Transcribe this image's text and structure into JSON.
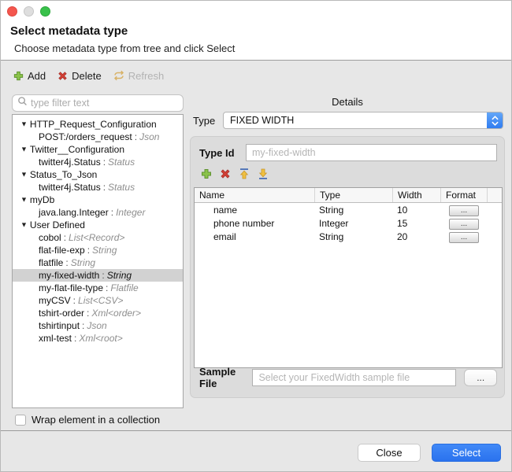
{
  "window": {
    "title": "Select metadata type",
    "subtitle": "Choose metadata type from tree and click Select"
  },
  "toolbar": {
    "add": "Add",
    "delete": "Delete",
    "refresh": "Refresh"
  },
  "filter": {
    "placeholder": "type filter text"
  },
  "tree": {
    "items": [
      {
        "label": "HTTP_Request_Configuration",
        "parent": true
      },
      {
        "label": "POST:/orders_request",
        "type": "Json"
      },
      {
        "label": "Twitter__Configuration",
        "parent": true
      },
      {
        "label": "twitter4j.Status",
        "type": "Status"
      },
      {
        "label": "Status_To_Json",
        "parent": true
      },
      {
        "label": "twitter4j.Status",
        "type": "Status"
      },
      {
        "label": "myDb",
        "parent": true
      },
      {
        "label": "java.lang.Integer",
        "type": "Integer"
      },
      {
        "label": "User Defined",
        "parent": true
      },
      {
        "label": "cobol",
        "type": "List<Record>"
      },
      {
        "label": "flat-file-exp",
        "type": "String"
      },
      {
        "label": "flatfile",
        "type": "String"
      },
      {
        "label": "my-fixed-width",
        "type": "String",
        "selected": true
      },
      {
        "label": "my-flat-file-type",
        "type": "Flatfile"
      },
      {
        "label": "myCSV",
        "type": "List<CSV>"
      },
      {
        "label": "tshirt-order",
        "type": "Xml<order>"
      },
      {
        "label": "tshirtinput",
        "type": "Json"
      },
      {
        "label": "xml-test",
        "type": "Xml<root>"
      }
    ]
  },
  "details": {
    "header": "Details",
    "type_label": "Type",
    "type_value": "FIXED WIDTH",
    "type_id_label": "Type Id",
    "type_id_placeholder": "my-fixed-width",
    "table": {
      "headers": [
        "Name",
        "Type",
        "Width",
        "Format"
      ],
      "rows": [
        {
          "name": "name",
          "type": "String",
          "width": "10",
          "format": "..."
        },
        {
          "name": "phone number",
          "type": "Integer",
          "width": "15",
          "format": "..."
        },
        {
          "name": "email",
          "type": "String",
          "width": "20",
          "format": "..."
        }
      ]
    },
    "sample_file_label": "Sample File",
    "sample_file_placeholder": "Select your FixedWidth sample file",
    "browse_button": "..."
  },
  "footer": {
    "wrap_checkbox_label": "Wrap element in a collection",
    "close_button": "Close",
    "select_button": "Select"
  },
  "colors": {
    "accent_blue": "#2f7cf6",
    "add_green": "#7cb342",
    "delete_red": "#d23f34",
    "refresh_tan": "#d8b267",
    "arrow_gold": "#f0c040",
    "selection_gray": "#d2d2d2"
  }
}
